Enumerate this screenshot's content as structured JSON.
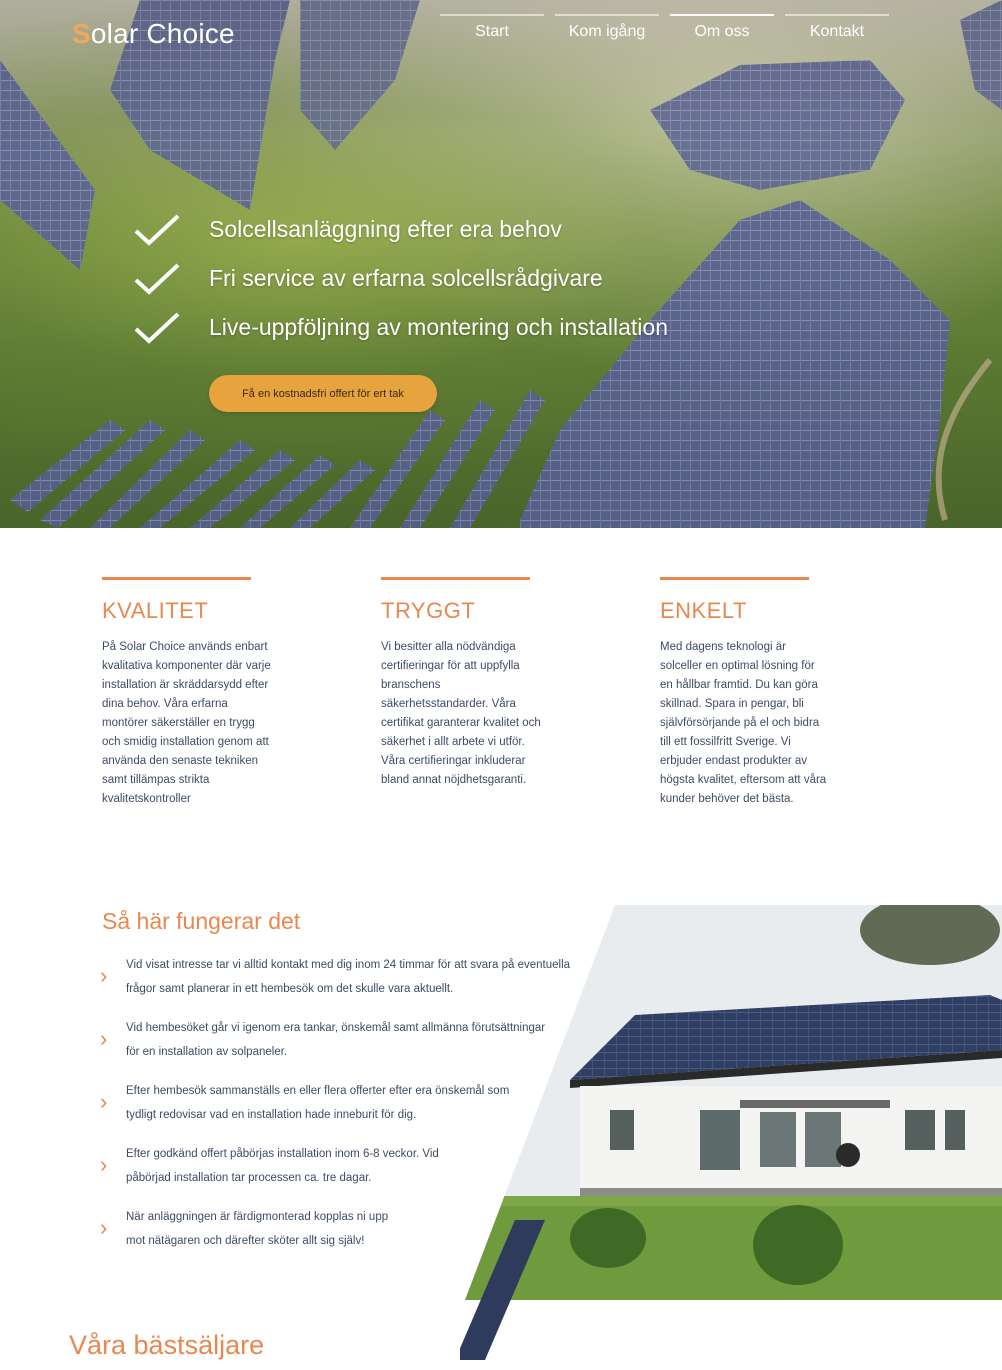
{
  "brand": {
    "logo_text": "Solar Choice",
    "logo_initial": "S",
    "logo_rest": "olar Choice",
    "accent_color": "#e8874f",
    "cta_color": "#e6a33e"
  },
  "nav": {
    "items": [
      "Start",
      "Kom igång",
      "Om oss",
      "Kontakt"
    ],
    "active": "Om oss"
  },
  "hero": {
    "bullets": [
      "Solcellsanläggning efter era behov",
      "Fri service av erfarna solcellsrådgivare",
      "Live-uppföljning av montering och installation"
    ],
    "cta_label": "Få en kostnadsfri offert för ert tak"
  },
  "features": [
    {
      "title": "KVALITET",
      "text": "På Solar Choice används enbart kvalitativa komponenter där varje installation är skräddarsydd efter dina behov. Våra erfarna montörer säkerställer en trygg och smidig installation genom att använda den senaste tekniken samt tillämpas strikta kvalitetskontroller"
    },
    {
      "title": "TRYGGT",
      "text": "Vi besitter alla nödvändiga certifieringar för att uppfylla branschens säkerhetsstandarder. Våra certifikat garanterar kvalitet och säkerhet i allt arbete vi utför. Våra certifieringar inkluderar bland annat nöjdhetsgaranti."
    },
    {
      "title": "ENKELT",
      "text": "Med dagens teknologi är solceller en optimal lösning för en hållbar framtid. Du kan göra skillnad. Spara in pengar, bli självförsörjande på el och bidra till ett fossilfritt Sverige. Vi erbjuder endast produkter av högsta kvalitet, eftersom att våra kunder behöver det bästa."
    }
  ],
  "how_it_works": {
    "title": "Så här fungerar det",
    "steps": [
      [
        "Vid visat intresse tar vi alltid kontakt med dig inom 24 timmar för att svara på eventuella",
        "frågor samt planerar in ett hembesök om det skulle vara aktuellt."
      ],
      [
        "Vid hembesöket går vi igenom era tankar, önskemål samt allmänna förutsättningar",
        "för en installation av solpaneler."
      ],
      [
        "Efter hembesök sammanställs en eller flera offerter efter era önskemål som",
        "tydligt redovisar vad en installation hade inneburit för dig."
      ],
      [
        "Efter godkänd offert påbörjas installation inom 6-8 veckor. Vid",
        "påbörjad installation tar processen ca. tre dagar."
      ],
      [
        "När anläggningen är färdigmonterad kopplas ni upp",
        "mot nätägaren och därefter sköter allt sig själv!"
      ]
    ]
  },
  "bestsellers": {
    "title": "Våra bästsäljare"
  }
}
